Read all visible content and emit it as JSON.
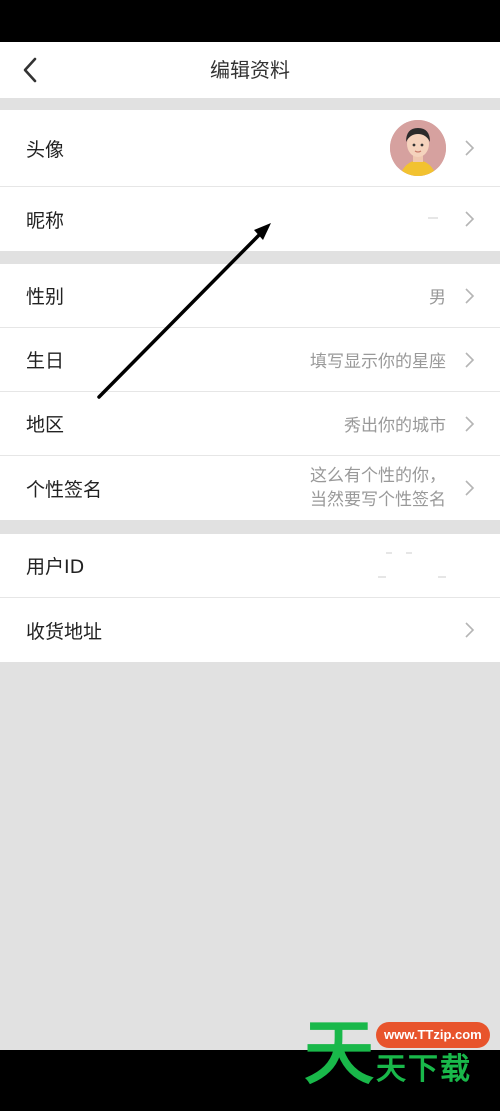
{
  "header": {
    "title": "编辑资料"
  },
  "profile_section": {
    "avatar_label": "头像",
    "nickname_label": "昵称"
  },
  "info_section": {
    "gender_label": "性别",
    "gender_value": "男",
    "birthday_label": "生日",
    "birthday_value": "填写显示你的星座",
    "region_label": "地区",
    "region_value": "秀出你的城市",
    "signature_label": "个性签名",
    "signature_value_line1": "这么有个性的你，",
    "signature_value_line2": "当然要写个性签名"
  },
  "account_section": {
    "user_id_label": "用户ID",
    "address_label": "收货地址"
  },
  "watermark": {
    "big_char": "天",
    "url": "www.TTzip.com",
    "text": "天下载"
  },
  "colors": {
    "accent_green": "#19b84a",
    "watermark_orange": "#e8542c",
    "background_gray": "#e1e1e1",
    "value_gray": "#999999"
  },
  "icons": {
    "back": "chevron-left-icon",
    "row_arrow": "chevron-right-icon"
  }
}
